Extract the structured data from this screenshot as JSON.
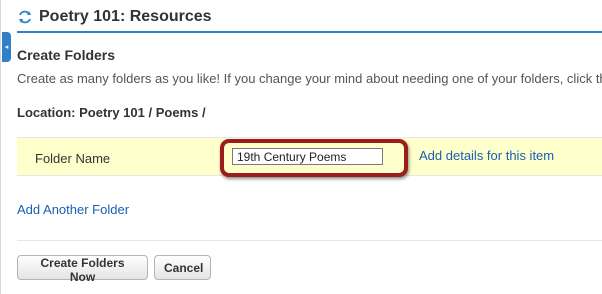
{
  "header": {
    "title": "Poetry 101: Resources",
    "icon": "refresh-icon"
  },
  "sidebar_toggle": {
    "glyph": "◂",
    "icon": "collapse-arrow-icon"
  },
  "section": {
    "title": "Create Folders",
    "instructions": "Create as many folders as you like! If you change your mind about needing one of your folders, click th",
    "location": "Location: Poetry 101 / Poems /"
  },
  "folder_row": {
    "label": "Folder Name",
    "value": "19th Century Poems",
    "details_link": "Add details for this item"
  },
  "add_another_link": "Add Another Folder",
  "buttons": {
    "create": "Create Folders Now",
    "cancel": "Cancel"
  },
  "colors": {
    "accent": "#2f80c8",
    "link": "#1a5fb4",
    "row_highlight": "#ffffcc",
    "callout": "#9b1c1c"
  }
}
